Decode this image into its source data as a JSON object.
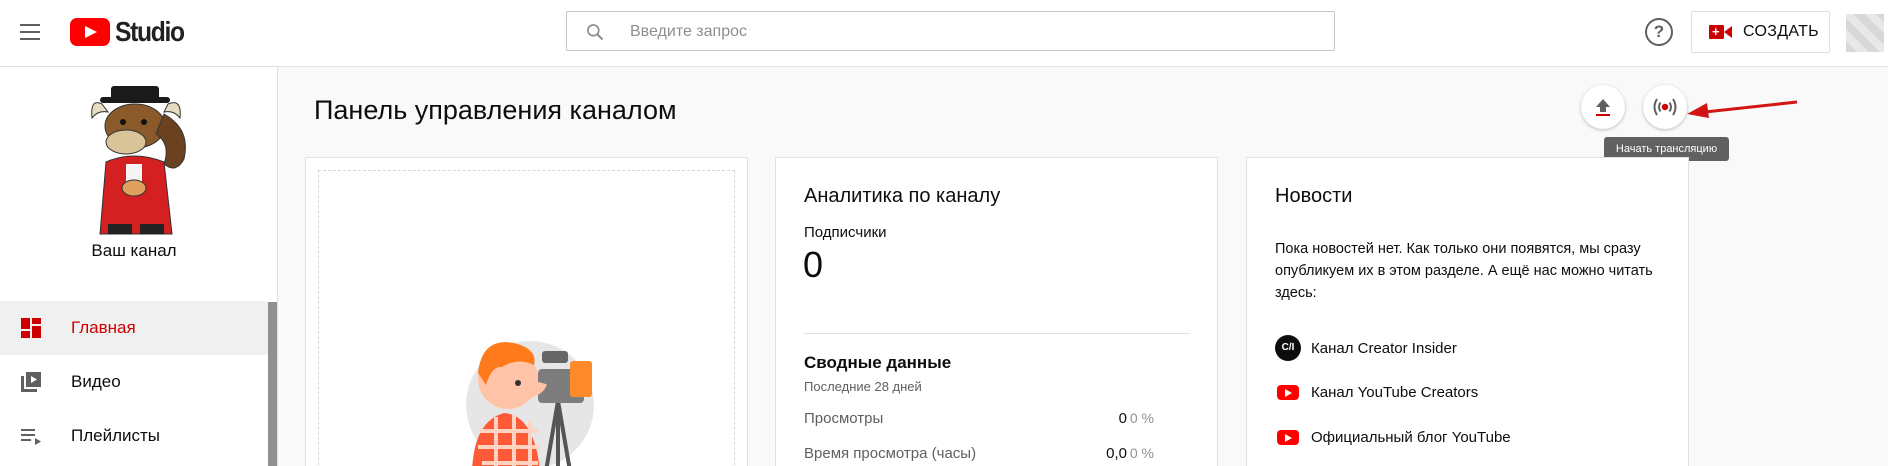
{
  "header": {
    "logo_text": "Studio",
    "search_placeholder": "Введите запрос",
    "help_symbol": "?",
    "create_label": "СОЗДАТЬ"
  },
  "sidebar": {
    "channel_name": "Ваш канал",
    "items": [
      {
        "label": "Главная",
        "icon": "dashboard-icon",
        "active": true
      },
      {
        "label": "Видео",
        "icon": "video-library-icon",
        "active": false
      },
      {
        "label": "Плейлисты",
        "icon": "playlist-icon",
        "active": false
      }
    ]
  },
  "main": {
    "title": "Панель управления каналом",
    "tooltip": "Начать трансляцию"
  },
  "analytics": {
    "title": "Аналитика по каналу",
    "subscribers_label": "Подписчики",
    "subscribers_value": "0",
    "summary_title": "Сводные данные",
    "summary_period": "Последние 28 дней",
    "metrics": [
      {
        "label": "Просмотры",
        "value": "0",
        "pct": "0 %"
      },
      {
        "label": "Время просмотра (часы)",
        "value": "0,0",
        "pct": "0 %"
      }
    ]
  },
  "news": {
    "title": "Новости",
    "text": "Пока новостей нет. Как только они появятся, мы сразу опубликуем их в этом разделе. А ещё нас можно читать здесь:",
    "links": [
      {
        "label": "Канал Creator Insider",
        "icon": "creator-insider-icon",
        "icon_text": "C/I"
      },
      {
        "label": "Канал YouTube Creators",
        "icon": "youtube-icon"
      },
      {
        "label": "Официальный блог YouTube",
        "icon": "youtube-icon"
      }
    ]
  },
  "colors": {
    "accent": "#cc0000",
    "youtube_red": "#ff0000",
    "arrow_red": "#d21414"
  }
}
